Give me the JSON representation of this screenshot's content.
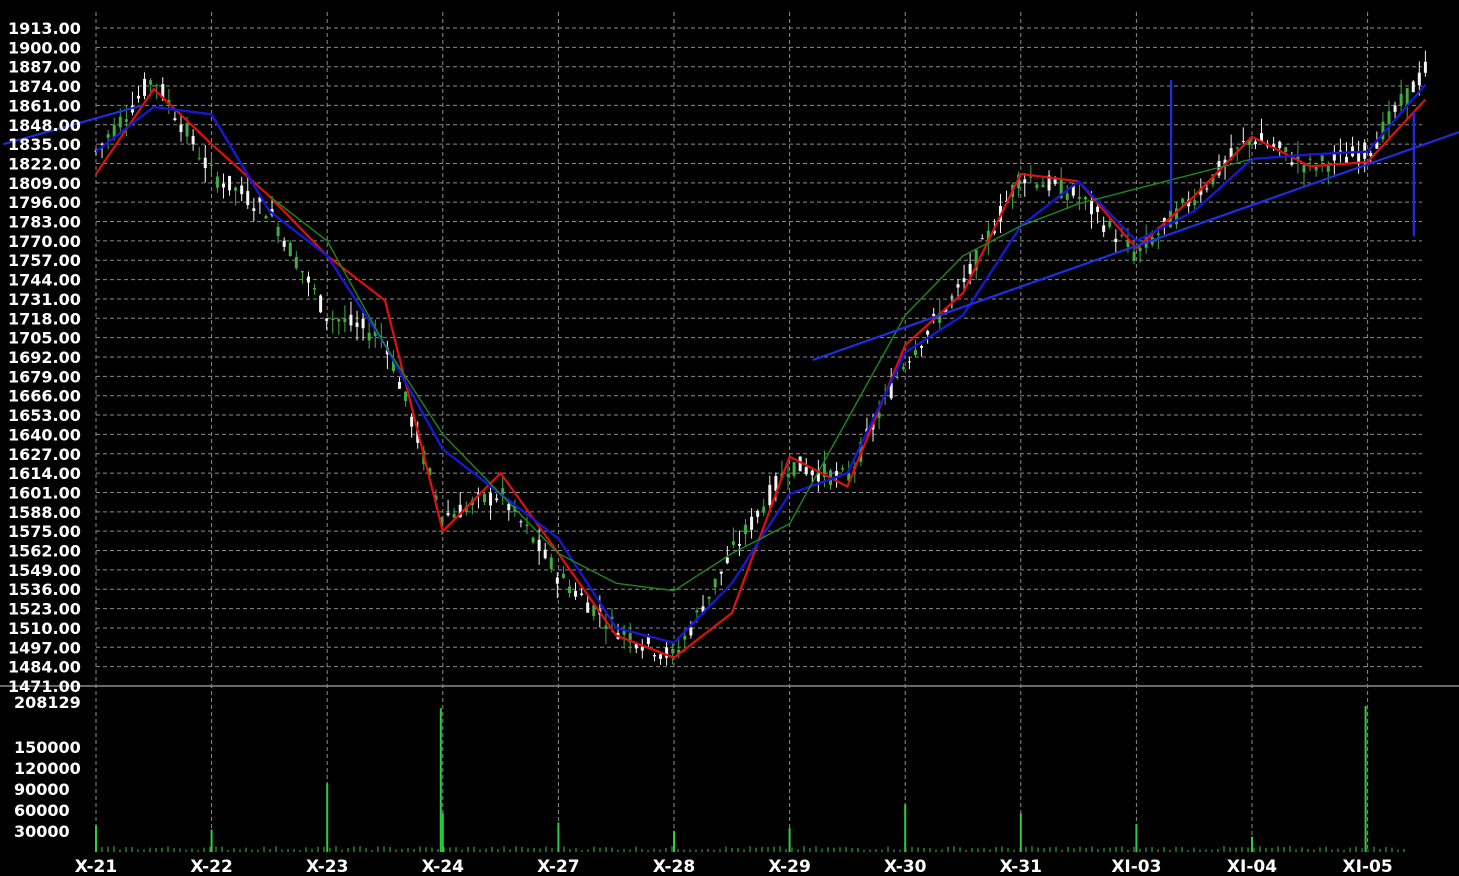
{
  "colors": {
    "background": "#000000",
    "grid": "#8c8c8c",
    "ma_short": "#e01010",
    "ma_mid": "#1818d0",
    "ma_long": "#1a8a1a",
    "trend": "#1f2fe0",
    "candle_up": "#f5f5f5",
    "candle_down": "#3fae3f",
    "volume": "#2ecc40",
    "text": "#ffffff"
  },
  "chart_data": {
    "type": "line",
    "price_axis": {
      "ticks": [
        "1913.00",
        "1900.00",
        "1887.00",
        "1874.00",
        "1861.00",
        "1848.00",
        "1835.00",
        "1822.00",
        "1809.00",
        "1796.00",
        "1783.00",
        "1770.00",
        "1757.00",
        "1744.00",
        "1731.00",
        "1718.00",
        "1705.00",
        "1692.00",
        "1679.00",
        "1666.00",
        "1653.00",
        "1640.00",
        "1627.00",
        "1614.00",
        "1601.00",
        "1588.00",
        "1575.00",
        "1562.00",
        "1549.00",
        "1536.00",
        "1523.00",
        "1510.00",
        "1497.00",
        "1484.00",
        "1471.00"
      ],
      "range": [
        1471,
        1913
      ],
      "grid": true
    },
    "volume_axis": {
      "ticks": [
        "208129",
        "150000",
        "120000",
        "90000",
        "60000",
        "30000"
      ],
      "range": [
        0,
        208129
      ]
    },
    "categories": [
      "X-21",
      "X-22",
      "X-23",
      "X-24",
      "X-27",
      "X-28",
      "X-29",
      "X-30",
      "X-31",
      "XI-03",
      "XI-04",
      "XI-05"
    ],
    "x": [
      0,
      0.5,
      1,
      1.5,
      2,
      2.5,
      3,
      3.5,
      4,
      4.5,
      5,
      5.5,
      6,
      6.5,
      7,
      7.5,
      8,
      8.5,
      9,
      9.5,
      10,
      10.5,
      11,
      11.5
    ],
    "close": [
      1830,
      1880,
      1815,
      1790,
      1720,
      1705,
      1585,
      1600,
      1545,
      1510,
      1490,
      1560,
      1620,
      1610,
      1690,
      1740,
      1815,
      1800,
      1760,
      1800,
      1840,
      1820,
      1830,
      1885
    ],
    "series": [
      {
        "style": "red",
        "values": [
          1815,
          1872,
          1835,
          1800,
          1760,
          1730,
          1575,
          1614,
          1560,
          1505,
          1490,
          1520,
          1625,
          1605,
          1700,
          1735,
          1815,
          1810,
          1765,
          1800,
          1840,
          1820,
          1823,
          1865
        ]
      },
      {
        "style": "blue",
        "values": [
          1830,
          1860,
          1855,
          1790,
          1760,
          1700,
          1630,
          1600,
          1570,
          1510,
          1500,
          1540,
          1600,
          1614,
          1695,
          1720,
          1780,
          1810,
          1770,
          1790,
          1825,
          1828,
          1830,
          1875
        ]
      },
      {
        "style": "green",
        "values": [
          null,
          null,
          null,
          1800,
          1770,
          1700,
          1640,
          1600,
          1560,
          1540,
          1535,
          1560,
          1580,
          1650,
          1720,
          1760,
          1780,
          1795,
          1805,
          1815,
          1825
        ]
      }
    ],
    "trendlines": [
      {
        "points": [
          [
            -0.8,
            1835
          ],
          [
            0.4,
            1861
          ]
        ]
      },
      {
        "points": [
          [
            6.2,
            1690
          ],
          [
            12.3,
            1857
          ]
        ]
      },
      {
        "points": [
          [
            9.3,
            1790
          ],
          [
            9.3,
            1878
          ]
        ]
      },
      {
        "points": [
          [
            11.4,
            1857
          ],
          [
            11.4,
            1773
          ]
        ]
      }
    ],
    "volume_spikes": [
      {
        "x": 0.0,
        "value": 38000
      },
      {
        "x": 1.0,
        "value": 32000
      },
      {
        "x": 2.0,
        "value": 98000
      },
      {
        "x": 3.0,
        "value": 205000
      },
      {
        "x": 3.0,
        "value": 55000
      },
      {
        "x": 4.0,
        "value": 42000
      },
      {
        "x": 5.0,
        "value": 30000
      },
      {
        "x": 6.0,
        "value": 34000
      },
      {
        "x": 7.0,
        "value": 68000
      },
      {
        "x": 8.0,
        "value": 55000
      },
      {
        "x": 9.0,
        "value": 40000
      },
      {
        "x": 10.0,
        "value": 22000
      },
      {
        "x": 11.0,
        "value": 208129
      }
    ]
  }
}
